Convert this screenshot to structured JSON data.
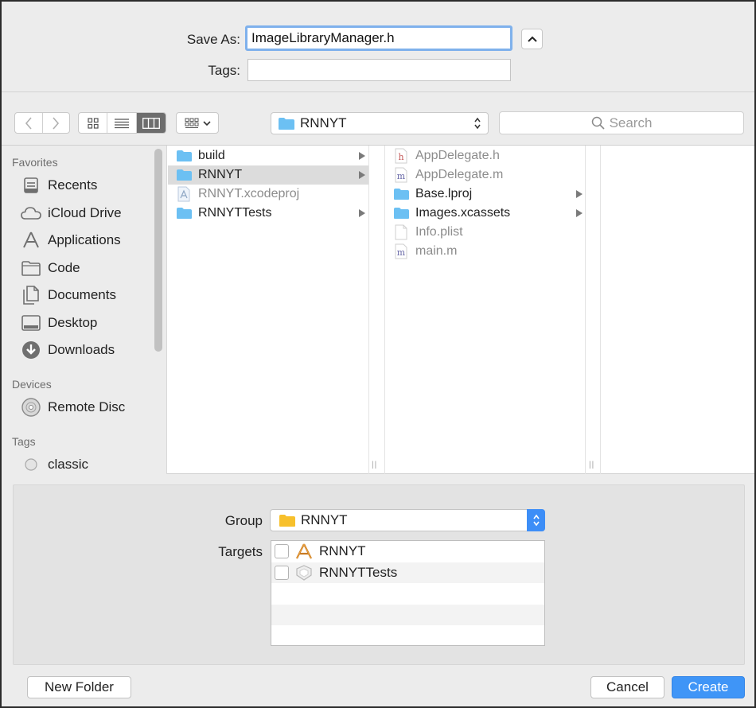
{
  "save": {
    "save_as_label": "Save As:",
    "file_name": "ImageLibraryManager.h",
    "tags_label": "Tags:",
    "tags_value": ""
  },
  "toolbar": {
    "path_folder": "RNNYT",
    "search_placeholder": "Search"
  },
  "sidebar": {
    "favorites_header": "Favorites",
    "favorites": [
      {
        "label": "Recents",
        "icon": "recents-icon"
      },
      {
        "label": "iCloud Drive",
        "icon": "cloud-icon"
      },
      {
        "label": "Applications",
        "icon": "applications-icon"
      },
      {
        "label": "Code",
        "icon": "folder-icon"
      },
      {
        "label": "Documents",
        "icon": "documents-icon"
      },
      {
        "label": "Desktop",
        "icon": "desktop-icon"
      },
      {
        "label": "Downloads",
        "icon": "downloads-icon"
      }
    ],
    "devices_header": "Devices",
    "devices": [
      {
        "label": "Remote Disc",
        "icon": "disc-icon"
      }
    ],
    "tags_header": "Tags",
    "tags": [
      {
        "label": "classic",
        "icon": "tag-circle-icon"
      }
    ]
  },
  "column1": [
    {
      "label": "build",
      "type": "folder",
      "has_children": true
    },
    {
      "label": "RNNYT",
      "type": "folder",
      "has_children": true,
      "selected": true
    },
    {
      "label": "RNNYT.xcodeproj",
      "type": "xcodeproj",
      "has_children": false
    },
    {
      "label": "RNNYTTests",
      "type": "folder",
      "has_children": true
    }
  ],
  "column2": [
    {
      "label": "AppDelegate.h",
      "type": "h-file",
      "has_children": false
    },
    {
      "label": "AppDelegate.m",
      "type": "m-file",
      "has_children": false
    },
    {
      "label": "Base.lproj",
      "type": "folder",
      "has_children": true
    },
    {
      "label": "Images.xcassets",
      "type": "folder",
      "has_children": true
    },
    {
      "label": "Info.plist",
      "type": "plist",
      "has_children": false
    },
    {
      "label": "main.m",
      "type": "m-file",
      "has_children": false
    }
  ],
  "accessory": {
    "group_label": "Group",
    "group_value": "RNNYT",
    "targets_label": "Targets",
    "targets": [
      {
        "label": "RNNYT",
        "icon": "app-target-icon",
        "checked": false
      },
      {
        "label": "RNNYTTests",
        "icon": "test-target-icon",
        "checked": false
      }
    ]
  },
  "buttons": {
    "new_folder": "New Folder",
    "cancel": "Cancel",
    "create": "Create"
  },
  "colors": {
    "accent": "#3f95f7",
    "folder_blue": "#6cc0f3",
    "group_folder": "#f7c02c"
  }
}
